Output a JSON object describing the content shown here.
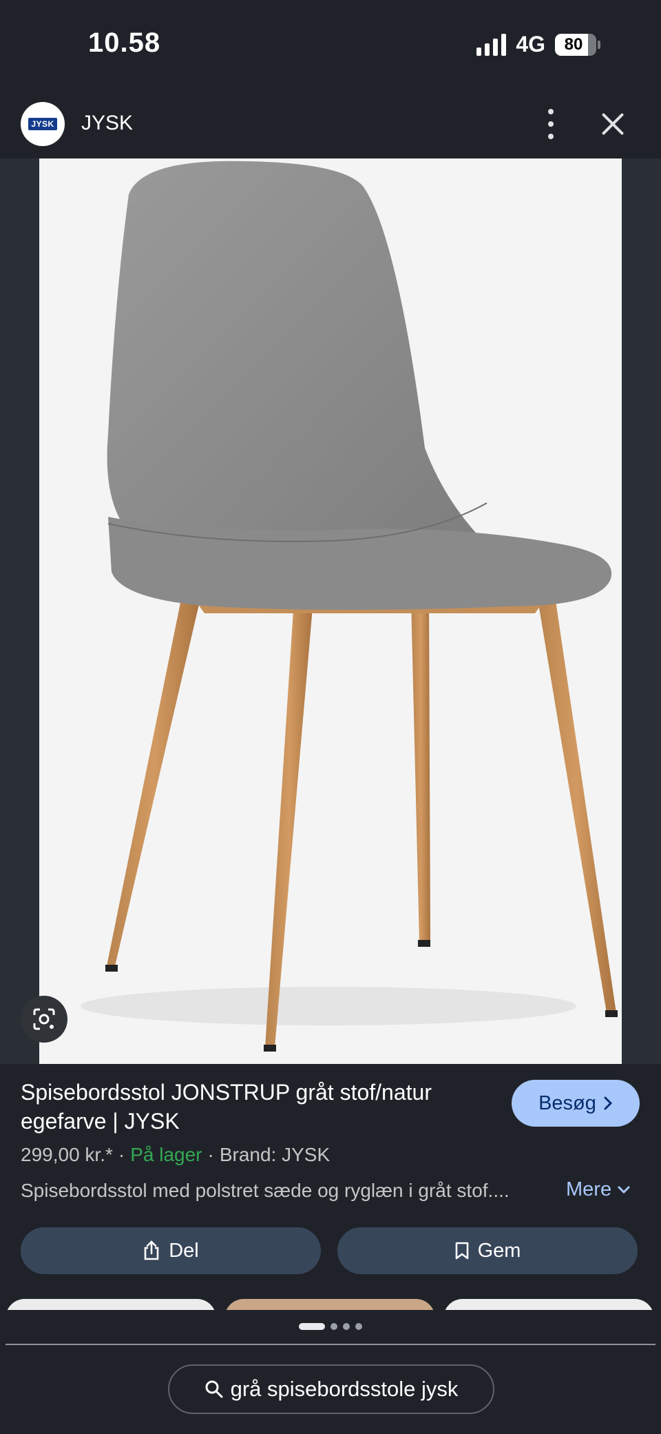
{
  "status_bar": {
    "time": "10.58",
    "network": "4G",
    "battery": "80",
    "battery_level_percent": 80,
    "signal_bars": 4
  },
  "header": {
    "site_name": "JYSK",
    "logo_text": "JYSK",
    "logo_color": "#143c8c"
  },
  "product": {
    "title": "Spisebordsstol JONSTRUP gråt stof/natur egefarve | JYSK",
    "price": "299,00 kr.*",
    "stock": "På lager",
    "brand": "Brand: JYSK",
    "description": "Spisebordsstol med polstret sæde og ryglæn i gråt stof....",
    "stock_color": "#34a853"
  },
  "actions": {
    "visit_label": "Besøg",
    "more_label": "Mere",
    "share_label": "Del",
    "save_label": "Gem"
  },
  "carousel": {
    "page_count": 4,
    "active_page": 1
  },
  "search": {
    "query": "grå spisebordsstole jysk"
  },
  "icons": {
    "header_more": "more-vert-icon",
    "header_close": "close-icon",
    "lens": "google-lens-icon",
    "visit": "chevron-right-icon",
    "more": "chevron-down-icon",
    "share": "share-icon",
    "save": "bookmark-icon",
    "search": "search-icon"
  },
  "colors": {
    "accent": "#a8c7fa",
    "button_bg": "#38465a",
    "background": "#1f2329"
  }
}
